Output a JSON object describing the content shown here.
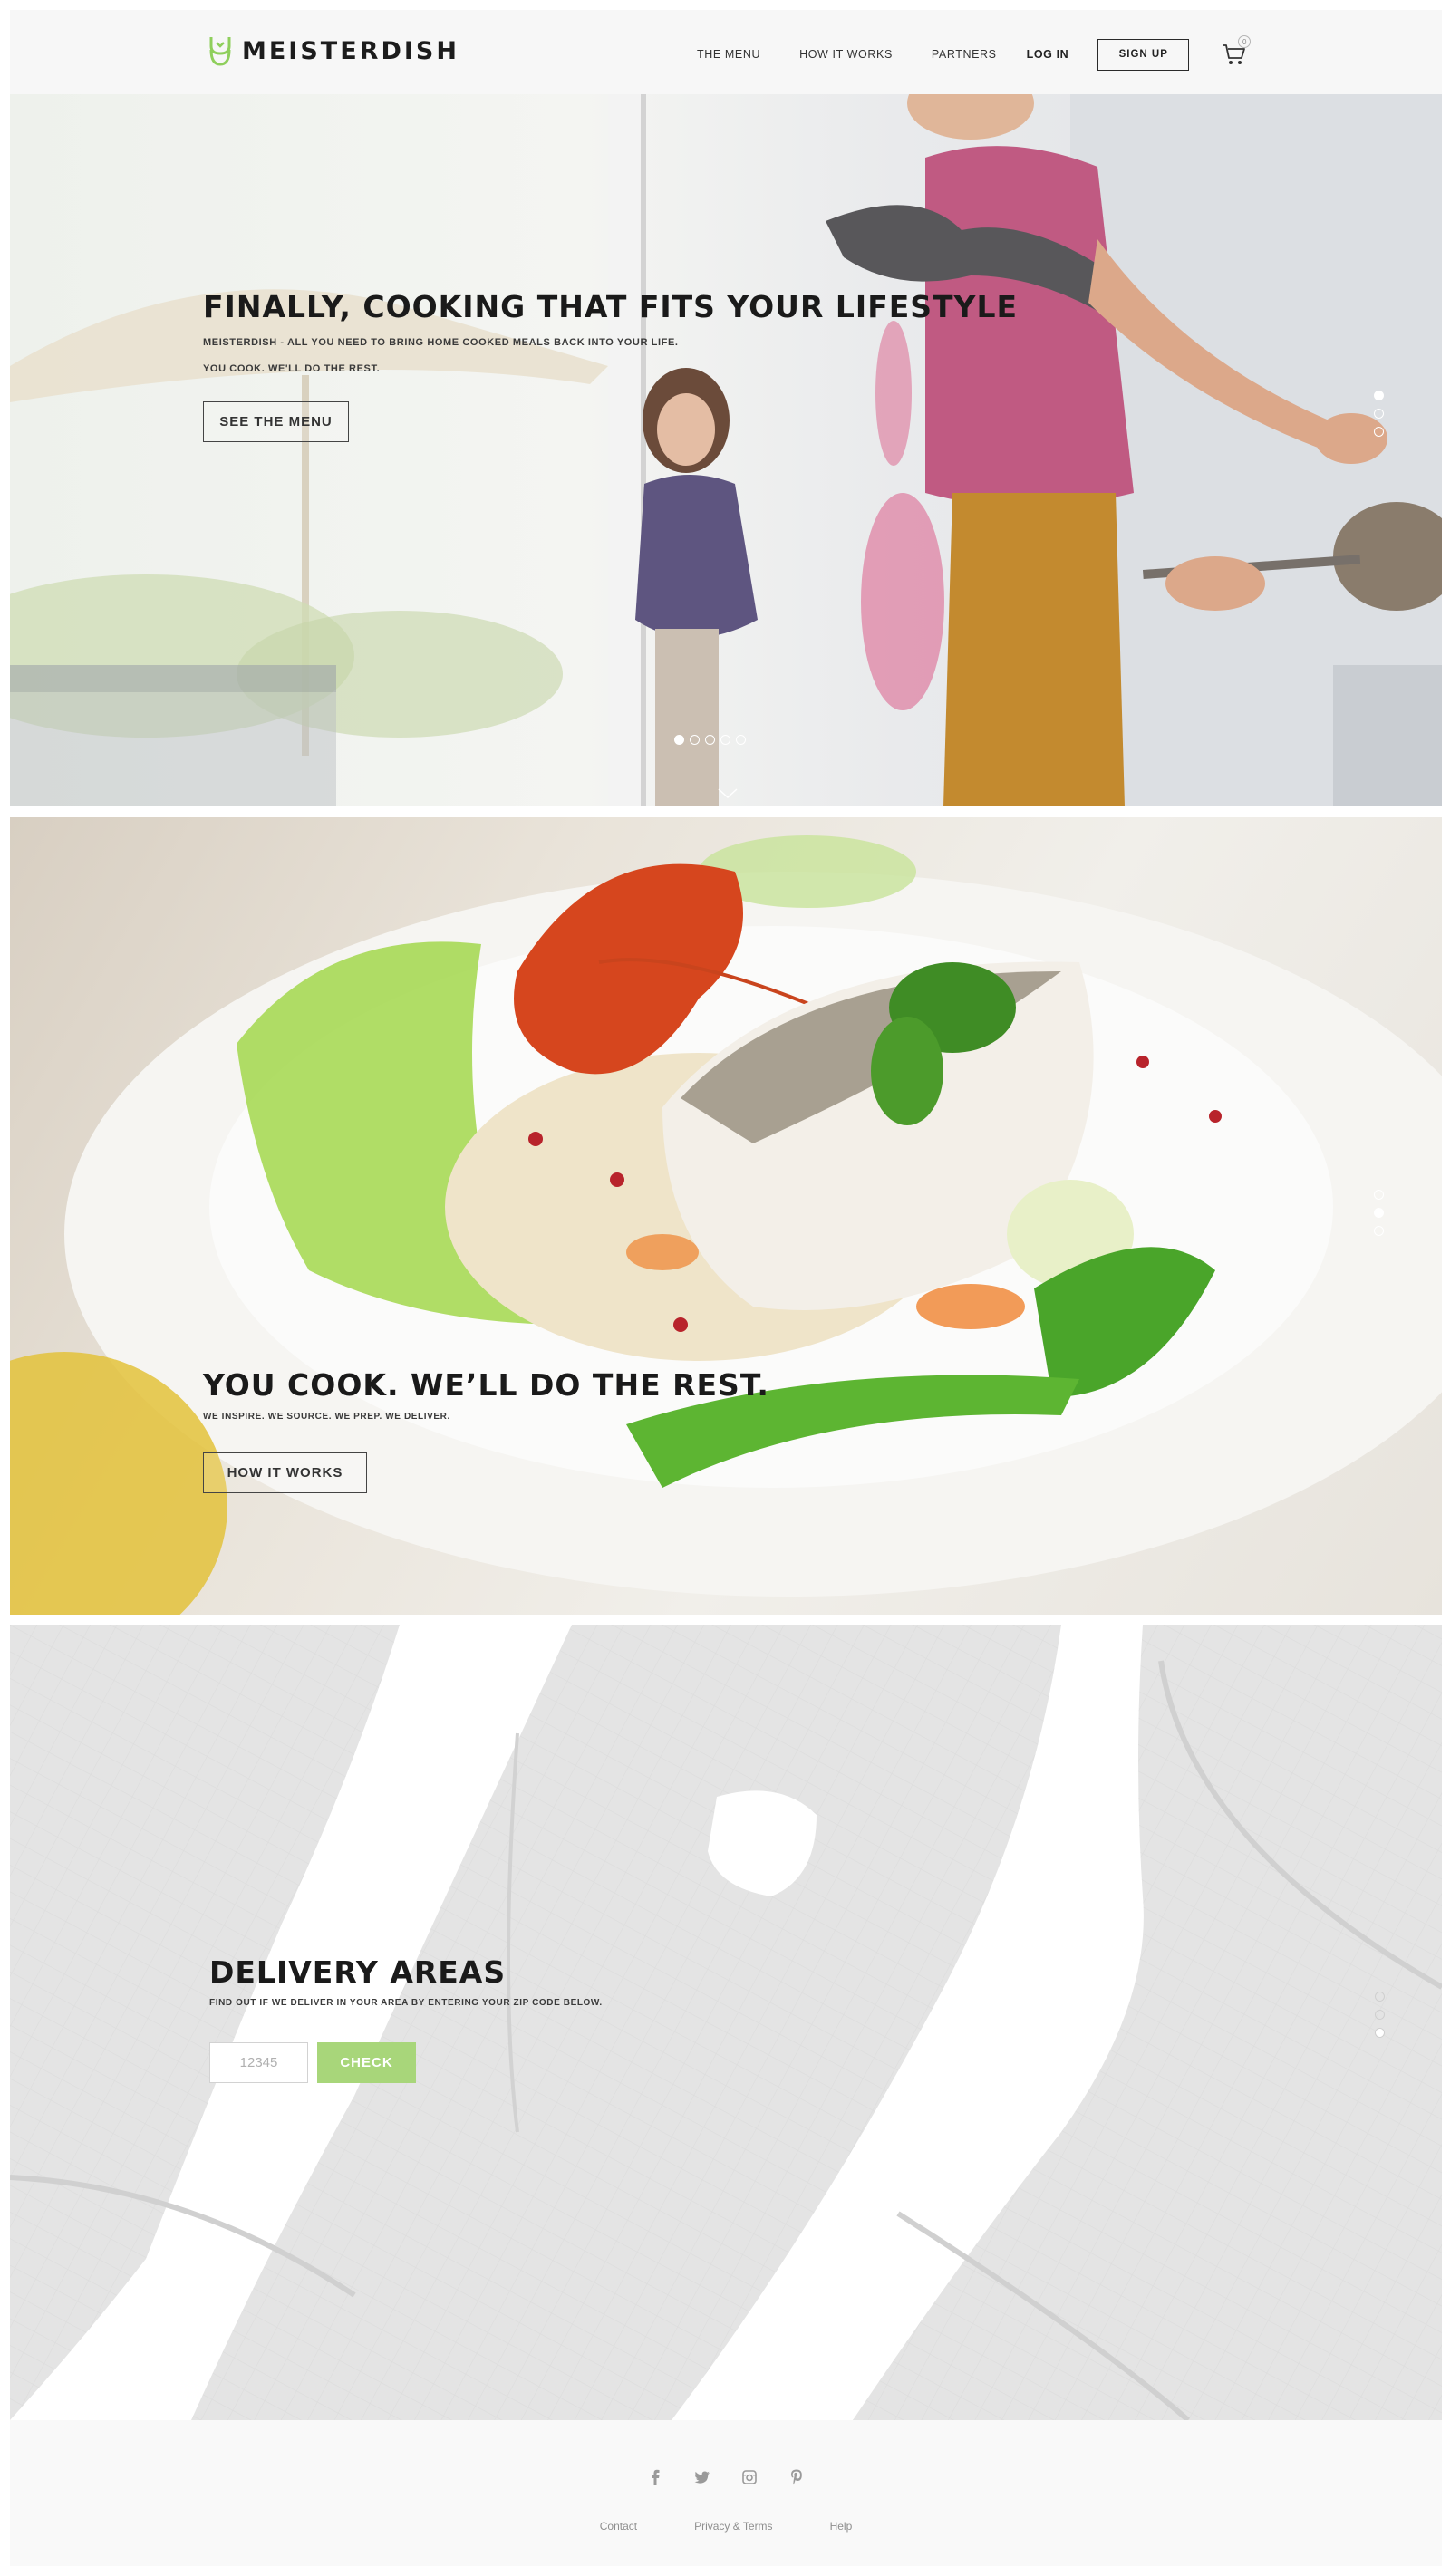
{
  "brand": {
    "name": "MEISTERDISH",
    "accent_color": "#a8d67a"
  },
  "header": {
    "nav": [
      {
        "label": "THE MENU",
        "icon": ""
      },
      {
        "label": "HOW IT WORKS"
      },
      {
        "label": "PARTNERS"
      },
      {
        "label": "LOG IN"
      }
    ],
    "signup_label": "SIGN UP",
    "cart": {
      "icon": "cart-icon",
      "count": "0"
    }
  },
  "hero": {
    "title": "FINALLY, COOKING THAT FITS YOUR LIFESTYLE",
    "subtitle": "MEISTERDISH - ALL YOU NEED TO BRING HOME COOKED MEALS BACK INTO YOUR LIFE.",
    "tagline": "YOU COOK. WE'LL DO THE REST.",
    "button_label": "SEE THE MENU",
    "slide_count": 5,
    "active_slide": 1,
    "section_index": 1
  },
  "food": {
    "title": "YOU COOK. WE’LL DO THE REST.",
    "subtitle": "WE INSPIRE. WE SOURCE. WE PREP. WE DELIVER.",
    "button_label": "HOW IT WORKS",
    "section_index": 2
  },
  "delivery": {
    "title": "DELIVERY AREAS",
    "subtitle": "FIND OUT IF WE DELIVER IN YOUR AREA BY ENTERING YOUR ZIP CODE BELOW.",
    "zip_placeholder": "12345",
    "check_label": "CHECK",
    "section_index": 3
  },
  "footer": {
    "social": [
      "facebook-icon",
      "twitter-icon",
      "instagram-icon",
      "pinterest-icon"
    ],
    "links": [
      "Contact",
      "Privacy & Terms",
      "Help"
    ]
  }
}
